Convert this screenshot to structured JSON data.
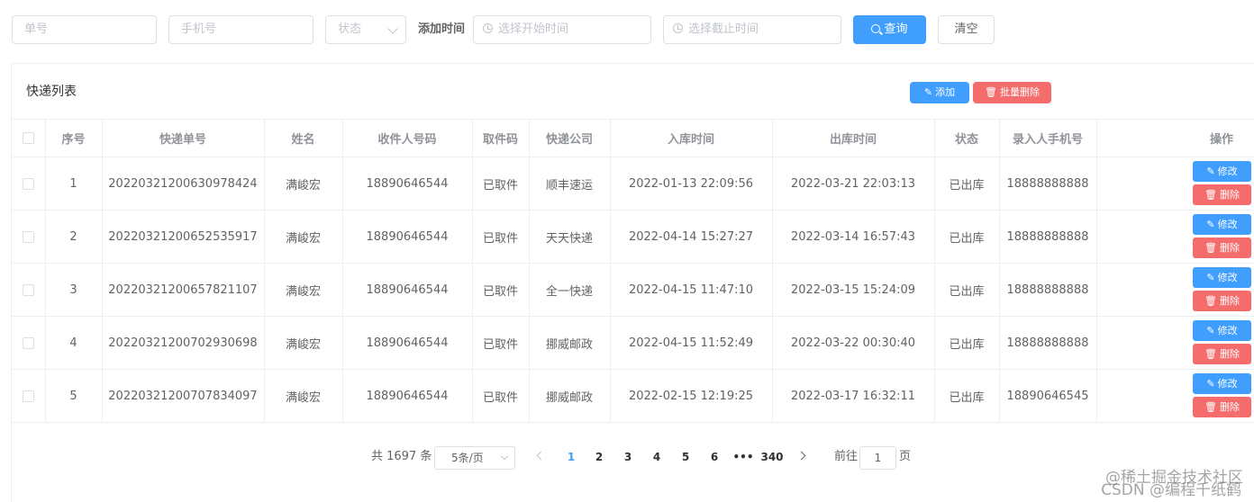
{
  "filters": {
    "order_placeholder": "单号",
    "phone_placeholder": "手机号",
    "status_placeholder": "状态",
    "add_time_label": "添加时间",
    "start_placeholder": "选择开始时间",
    "end_placeholder": "选择截止时间",
    "query_label": "查询",
    "clear_label": "清空"
  },
  "card": {
    "title": "快递列表",
    "add_label": "添加",
    "batch_delete_label": "批量删除"
  },
  "table": {
    "headers": [
      "序号",
      "快递单号",
      "姓名",
      "收件人号码",
      "取件码",
      "快递公司",
      "入库时间",
      "出库时间",
      "状态",
      "录入人手机号",
      "操作"
    ],
    "rows": [
      [
        "1",
        "20220321200630978424",
        "满峻宏",
        "18890646544",
        "已取件",
        "顺丰速运",
        "2022-01-13 22:09:56",
        "2022-03-21 22:03:13",
        "已出库",
        "18888888888"
      ],
      [
        "2",
        "20220321200652535917",
        "满峻宏",
        "18890646544",
        "已取件",
        "天天快递",
        "2022-04-14 15:27:27",
        "2022-03-14 16:57:43",
        "已出库",
        "18888888888"
      ],
      [
        "3",
        "20220321200657821107",
        "满峻宏",
        "18890646544",
        "已取件",
        "全一快递",
        "2022-04-15 11:47:10",
        "2022-03-15 15:24:09",
        "已出库",
        "18888888888"
      ],
      [
        "4",
        "20220321200702930698",
        "满峻宏",
        "18890646544",
        "已取件",
        "挪威邮政",
        "2022-04-15 11:52:49",
        "2022-03-22 00:30:40",
        "已出库",
        "18888888888"
      ],
      [
        "5",
        "20220321200707834097",
        "满峻宏",
        "18890646544",
        "已取件",
        "挪威邮政",
        "2022-02-15 12:19:25",
        "2022-03-17 16:32:11",
        "已出库",
        "18890646545"
      ]
    ],
    "edit_label": "修改",
    "delete_label": "删除"
  },
  "pagination": {
    "total": "共 1697 条",
    "page_size": "5条/页",
    "pages": [
      "1",
      "2",
      "3",
      "4",
      "5",
      "6",
      "•••",
      "340"
    ],
    "current_page": "1",
    "goto_label": "前往",
    "goto_value": "1",
    "page_suffix": "页"
  },
  "watermark": {
    "line1": "@稀土掘金技术社区",
    "line2": "CSDN @编程千纸鹤"
  }
}
